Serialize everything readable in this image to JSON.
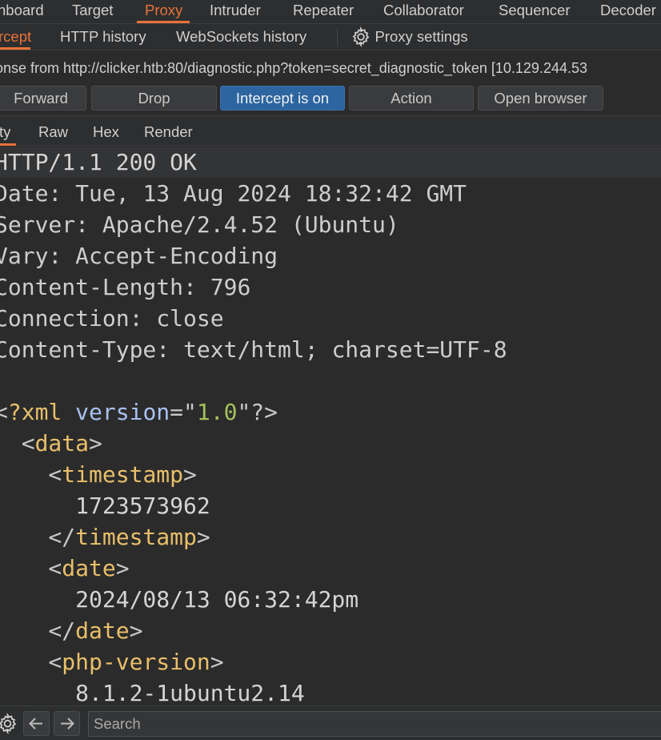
{
  "top_tabs": [
    {
      "label": "nboard"
    },
    {
      "label": "Target"
    },
    {
      "label": "Proxy",
      "active": true
    },
    {
      "label": "Intruder"
    },
    {
      "label": "Repeater"
    },
    {
      "label": "Collaborator"
    },
    {
      "label": "Sequencer"
    },
    {
      "label": "Decoder"
    }
  ],
  "sub_tabs": [
    {
      "label": "rcept",
      "active": true
    },
    {
      "label": "HTTP history"
    },
    {
      "label": "WebSockets history"
    }
  ],
  "proxy_settings_label": "Proxy settings",
  "status_line": "onse from http://clicker.htb:80/diagnostic.php?token=secret_diagnostic_token  [10.129.244.53",
  "buttons": {
    "forward": "Forward",
    "drop": "Drop",
    "intercept": "Intercept is on",
    "action": "Action",
    "open_browser": "Open browser"
  },
  "editor_tabs": [
    {
      "label": "ty",
      "active": true
    },
    {
      "label": "Raw"
    },
    {
      "label": "Hex"
    },
    {
      "label": "Render"
    }
  ],
  "editor_lines": [
    [
      [
        "HTTP/1.1 200 OK",
        "text"
      ]
    ],
    [
      [
        "Date:",
        "hname"
      ],
      [
        " Tue, 13 Aug 2024 18:32:42 GMT",
        "hval"
      ]
    ],
    [
      [
        "Server:",
        "hname"
      ],
      [
        " Apache/2.4.52 (Ubuntu)",
        "hval"
      ]
    ],
    [
      [
        "Vary:",
        "hname"
      ],
      [
        " Accept-Encoding",
        "hval"
      ]
    ],
    [
      [
        "Content-Length:",
        "hname"
      ],
      [
        " 796",
        "hval"
      ]
    ],
    [
      [
        "Connection:",
        "hname"
      ],
      [
        " close",
        "hval"
      ]
    ],
    [
      [
        "Content-Type:",
        "hname"
      ],
      [
        " text/html; charset=UTF-8",
        "hval"
      ]
    ],
    [],
    [
      [
        "<",
        "punc"
      ],
      [
        "?xml",
        "tag"
      ],
      [
        " version",
        "attr"
      ],
      [
        "=\"",
        "punc"
      ],
      [
        "1.0",
        "val"
      ],
      [
        "\"?>",
        "punc"
      ]
    ],
    [
      [
        "  <",
        "punc"
      ],
      [
        "data",
        "tag"
      ],
      [
        ">",
        "punc"
      ]
    ],
    [
      [
        "    <",
        "punc"
      ],
      [
        "timestamp",
        "tag"
      ],
      [
        ">",
        "punc"
      ]
    ],
    [
      [
        "      1723573962",
        "text"
      ]
    ],
    [
      [
        "    </",
        "punc"
      ],
      [
        "timestamp",
        "tag"
      ],
      [
        ">",
        "punc"
      ]
    ],
    [
      [
        "    <",
        "punc"
      ],
      [
        "date",
        "tag"
      ],
      [
        ">",
        "punc"
      ]
    ],
    [
      [
        "      2024/08/13 06:32:42pm",
        "text"
      ]
    ],
    [
      [
        "    </",
        "punc"
      ],
      [
        "date",
        "tag"
      ],
      [
        ">",
        "punc"
      ]
    ],
    [
      [
        "    <",
        "punc"
      ],
      [
        "php-version",
        "tag"
      ],
      [
        ">",
        "punc"
      ]
    ],
    [
      [
        "      8.1.2-1ubuntu2.14",
        "text"
      ]
    ]
  ],
  "search": {
    "placeholder": "Search",
    "value": ""
  },
  "colors": {
    "accent": "#e8733a",
    "primary_button": "#2c65a0",
    "xml_tag": "#e8bf6a",
    "xml_attr": "#a9c1f0",
    "xml_value": "#a5c25c"
  }
}
